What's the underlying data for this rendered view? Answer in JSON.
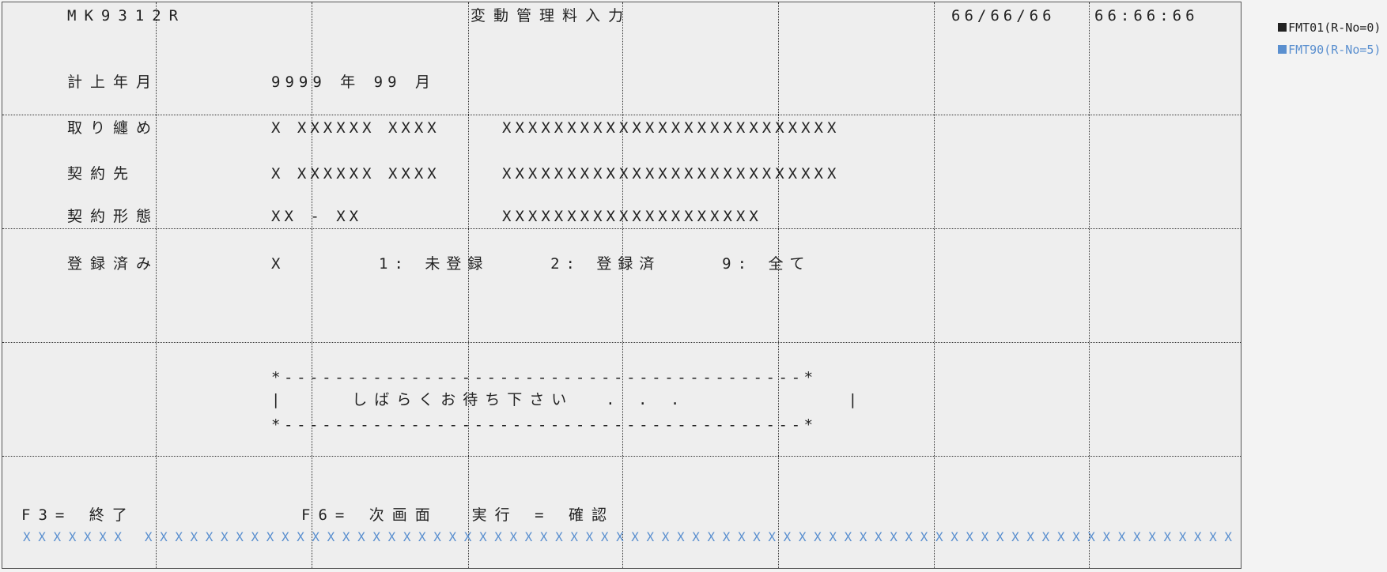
{
  "header": {
    "program_id": "MK9312R",
    "title": "変動管理料入力",
    "date": "66/66/66",
    "time": "66:66:66"
  },
  "rows": {
    "fiscal_label": "計上年月",
    "fiscal_value": "9999 年 99 月",
    "torimatome_label": "取り纏め",
    "torimatome_code": "X XXXXXX XXXX",
    "torimatome_name": "XXXXXXXXXXXXXXXXXXXXXXXXXX",
    "keiyakusaki_label": "契約先",
    "keiyakusaki_code": "X XXXXXX XXXX",
    "keiyakusaki_name": "XXXXXXXXXXXXXXXXXXXXXXXXXX",
    "keitai_label": "契約形態",
    "keitai_code": "XX - XX",
    "keitai_name": "XXXXXXXXXXXXXXXXXXXX",
    "registered_label": "登録済み",
    "registered_value": "X",
    "registered_options": "1: 未登録    2: 登録済    9: 全て"
  },
  "wait_box": {
    "top": "*-----------------------------------------*",
    "message": "|    しばらくお待ち下さい  . . .          |",
    "bottom": "*-----------------------------------------*"
  },
  "footer": {
    "f3": "F3= 終了",
    "f6": "F6= 次画面  実行 = 確認",
    "message_line": "XXXXXXX XXXXXXXXXXXXXXXXXXXXXXXXXXXXXXXXXXXXXXXXXXXXXXXXXXXXXXXXXXXXXXXXXXXXXXXX"
  },
  "legend": [
    {
      "label": "FMT01(R-No=0)",
      "color": "#222222"
    },
    {
      "label": "FMT90(R-No=5)",
      "color": "#5a8fcf"
    }
  ]
}
